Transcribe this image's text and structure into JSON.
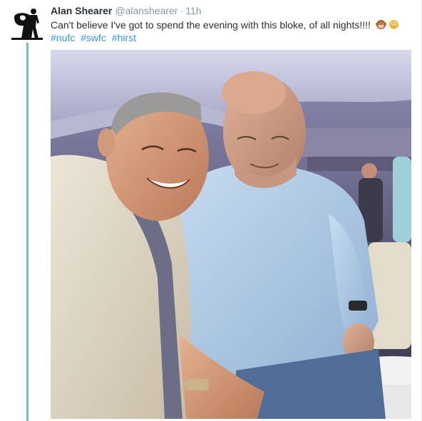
{
  "tweet": {
    "display_name": "Alan Shearer",
    "username": "@alanshearer",
    "separator": "·",
    "time": "11h",
    "text": "Can't believe I've got to spend the evening with this bloke, of all nights!!!!",
    "emojis": [
      "see-no-evil-monkey-icon",
      "flushed-face-icon"
    ],
    "hashtags": [
      "#nufc",
      "#swfc",
      "#hirst"
    ]
  },
  "avatar": {
    "icon": "silhouette-number-9-logo"
  },
  "media": {
    "kind": "photo"
  },
  "colors": {
    "name": "#292f33",
    "muted": "#8899a6",
    "hashtag": "#3b94d9",
    "thread_line": "#5fc4d9"
  }
}
